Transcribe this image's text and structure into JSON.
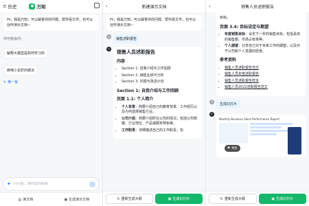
{
  "screen1": {
    "history": "历史",
    "brand": "万知",
    "greeting": "Hi，我是万知，可以解答你的问题、帮你看文件，也可以创作演示文档~",
    "ask_label": "你可能会问:",
    "suggestions": [
      "解释大模型是如何学习的",
      "麻辣小龙虾的做法"
    ],
    "refresh": "换一批",
    "input_placeholder": "问问题，随时帮你解答",
    "tabs": [
      "读文档",
      "生成演示文档"
    ]
  },
  "screen2": {
    "title": "新建演示文档",
    "greeting": "Hi，我是万知，可以解答你的问题、帮你看文件，也可以创作演示文档~",
    "user_msg": "销售述职报告",
    "doc_title": "销售人员述职报告",
    "content_heading": "内容",
    "sections": [
      "Section 1: 自我介绍与工作回顾",
      "Section 2: 销售业绩与分析",
      "Section 3: 问题与改进计划"
    ],
    "section1_heading": "Section 1: 自我介绍与工作回顾",
    "page_heading": "页面 1.1: 个人简介",
    "bullets": [
      {
        "k": "个人背景",
        "v": "简要介绍自己的教育背景、工作经历以及为何选择销售行业。"
      },
      {
        "k": "公司介绍",
        "v": "简要介绍所在公司的情况，包括公司规模、行业地位、产品或服务特色等。"
      },
      {
        "k": "工作职责",
        "v": "详细描述自己的工作职责，包"
      }
    ],
    "btn_regen": "重新生成大纲",
    "btn_gen": "生成幻灯片"
  },
  "screen3": {
    "title": "销售人员述职报告",
    "intro_fragment": "目标。",
    "page_heading": "页面 3.4: 目标设定与期望",
    "bullets": [
      {
        "k": "年度销售目标",
        "v": "设定下一年的销售目标，包括具体的销售额、市场占有率等。"
      },
      {
        "k": "个人期望",
        "v": "分享自己对于未来工作的期望，以及对于公司和个人发展的愿景。"
      }
    ],
    "ref_heading": "参考资料",
    "refs": [
      "销售人员述职报告范文",
      "销售人员年度述职报告",
      "销售人员述职报告样本",
      "销售人员2022述职报告范文"
    ],
    "gen_msg": "生成幻灯片",
    "thumb_title": "Monthly Business Sales Performance Report",
    "preview": "预览",
    "btn_regen": "重新生成大纲",
    "btn_gen": "生成幻灯片"
  },
  "colors": {
    "accent": "#15b76a",
    "link": "#1677ff",
    "user_bubble": "#e8f4ff"
  }
}
